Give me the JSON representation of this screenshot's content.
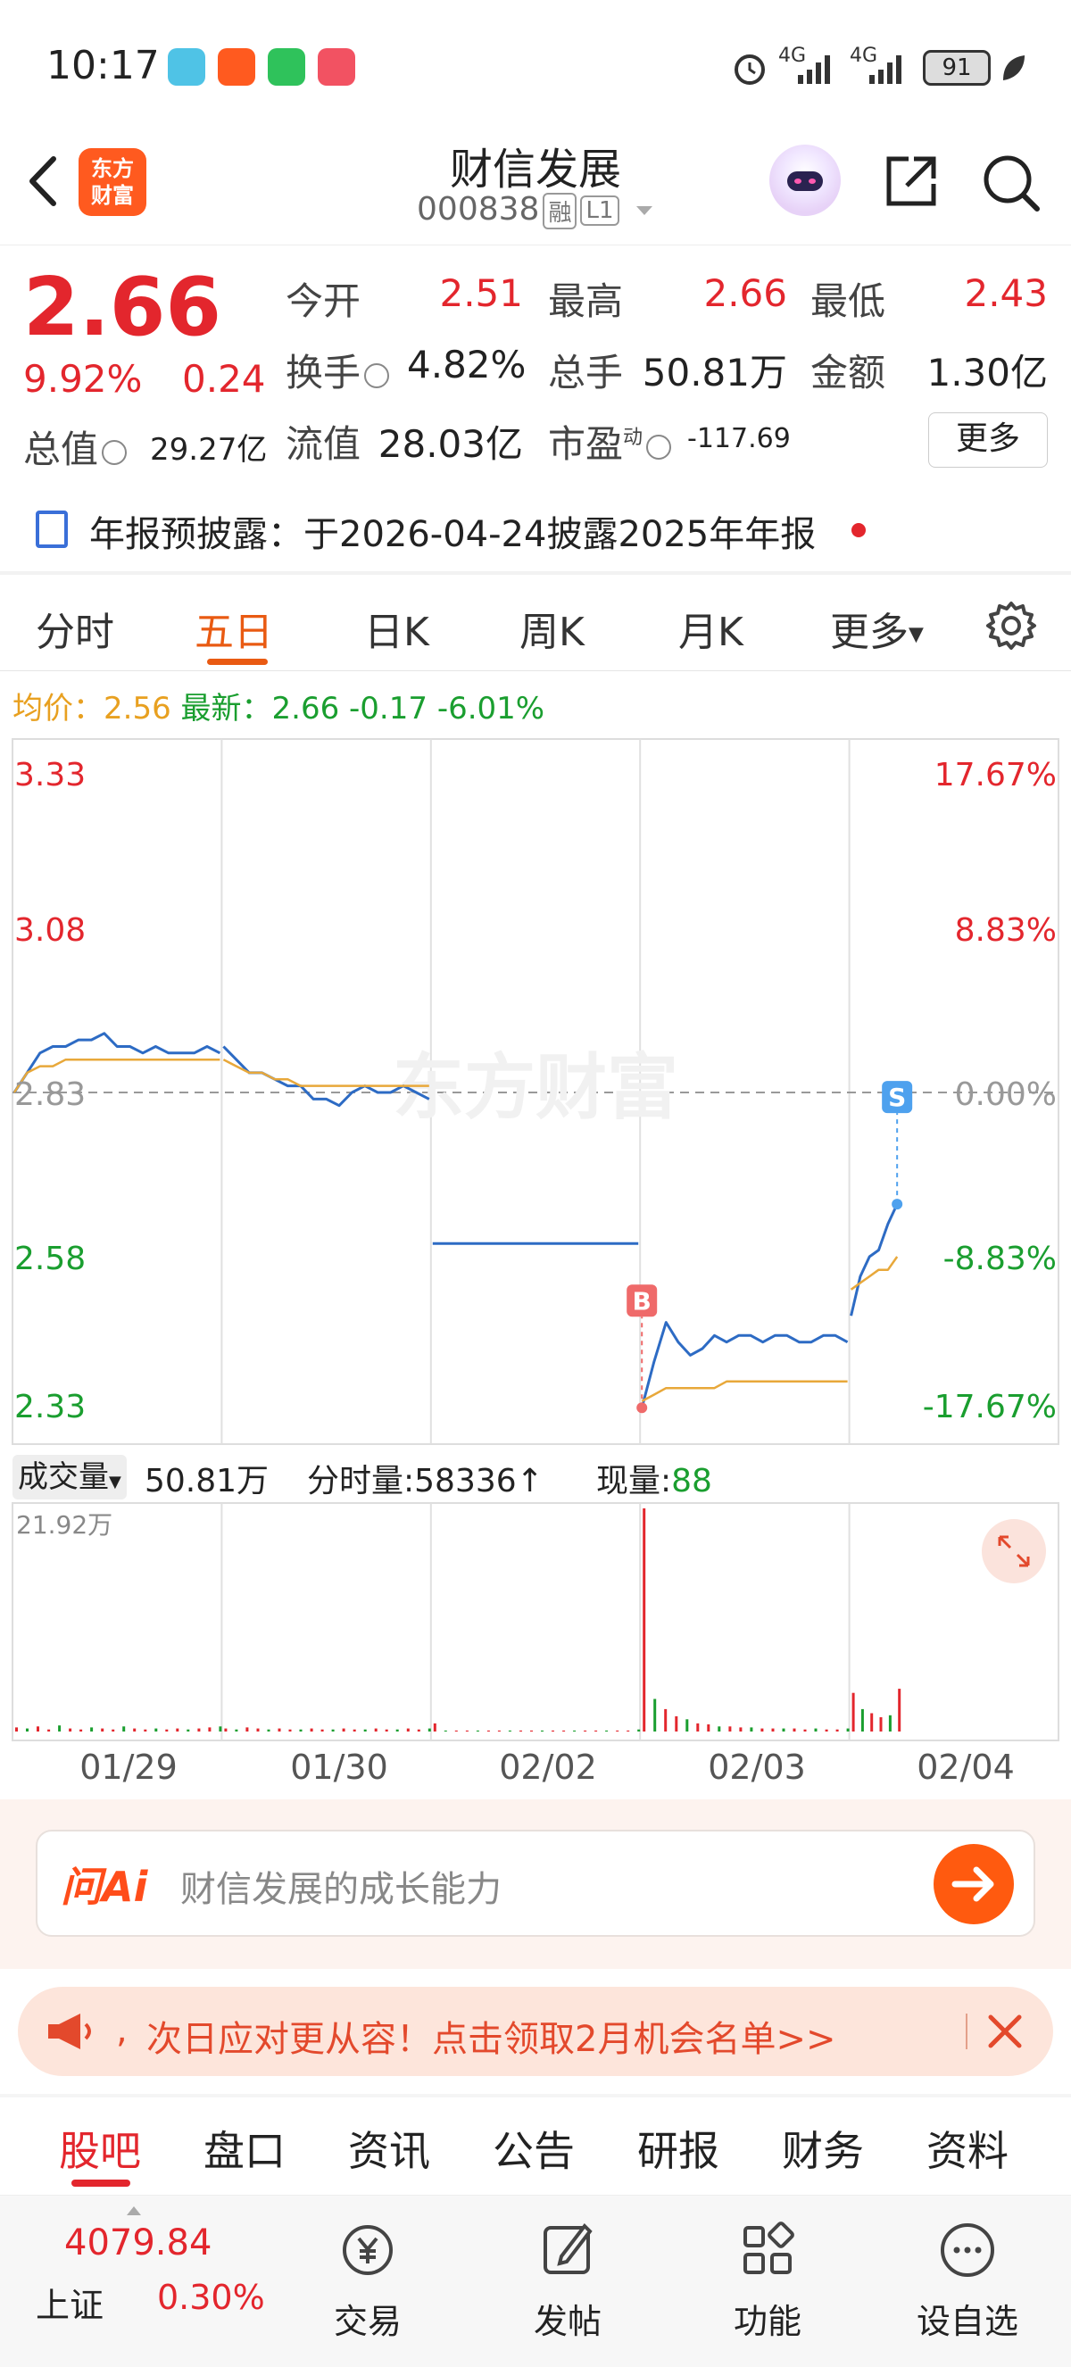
{
  "status_bar": {
    "time": "10:17",
    "network1": "4G",
    "network2": "4G",
    "battery": "91"
  },
  "header": {
    "logo_text_line1": "东方",
    "logo_text_line2": "财富",
    "stock_name": "财信发展",
    "stock_code": "000838",
    "tag_margin": "融",
    "tag_level": "L1"
  },
  "quote": {
    "price": "2.66",
    "change_pct": "9.92%",
    "change": "0.24",
    "market_value_label": "总值",
    "market_value": "29.27亿",
    "open_label": "今开",
    "open": "2.51",
    "high_label": "最高",
    "high": "2.66",
    "low_label": "最低",
    "low": "2.43",
    "turnover_label": "换手",
    "turnover": "4.82%",
    "volume_label": "总手",
    "volume": "50.81万",
    "amount_label": "金额",
    "amount": "1.30亿",
    "float_value_label": "流值",
    "float_value": "28.03亿",
    "pe_label": "市盈",
    "pe_superscript": "动",
    "pe": "-117.69",
    "more_button": "更多"
  },
  "disclosure": {
    "text": "年报预披露：于2026-04-24披露2025年年报"
  },
  "chart_tabs": [
    "分时",
    "五日",
    "日K",
    "周K",
    "月K",
    "更多"
  ],
  "chart_tab_active": "五日",
  "avg_line": {
    "avg_label": "均价：",
    "avg": "2.56",
    "latest_label": "最新：",
    "latest": "2.66",
    "change": "-0.17",
    "change_pct": "-6.01%"
  },
  "watermark": "东方财富",
  "chart_data": {
    "type": "line",
    "title": "",
    "x": [
      "01/29",
      "01/30",
      "02/02",
      "02/03",
      "02/04"
    ],
    "y_ticks_left": [
      "3.33",
      "3.08",
      "2.83",
      "2.58",
      "2.33"
    ],
    "y_ticks_right": [
      "17.67%",
      "8.83%",
      "0.00%",
      "-8.83%",
      "-17.67%"
    ],
    "ylim": [
      2.33,
      3.33
    ],
    "prev_close": 2.83,
    "grid": true,
    "series": [
      {
        "name": "",
        "color": "#2d6bc4",
        "days": [
          {
            "day": "01/29",
            "values": [
              2.83,
              2.86,
              2.89,
              2.9,
              2.9,
              2.91,
              2.91,
              2.92,
              2.9,
              2.9,
              2.89,
              2.9,
              2.89,
              2.89,
              2.89,
              2.9,
              2.89
            ]
          },
          {
            "day": "01/30",
            "values": [
              2.9,
              2.88,
              2.86,
              2.86,
              2.85,
              2.84,
              2.84,
              2.82,
              2.82,
              2.81,
              2.83,
              2.84,
              2.83,
              2.83,
              2.84,
              2.83,
              2.82
            ]
          },
          {
            "day": "02/02",
            "values": [
              2.6,
              2.6
            ]
          },
          {
            "day": "02/03",
            "values": [
              2.35,
              2.42,
              2.48,
              2.45,
              2.43,
              2.44,
              2.46,
              2.45,
              2.46,
              2.46,
              2.45,
              2.46,
              2.46,
              2.45,
              2.45,
              2.46,
              2.46,
              2.45
            ]
          },
          {
            "day": "02/04",
            "values": [
              2.49,
              2.55,
              2.58,
              2.59,
              2.63,
              2.66
            ]
          }
        ]
      },
      {
        "name": "",
        "color": "#e8a83a",
        "days": [
          {
            "day": "01/29",
            "values": [
              2.83,
              2.86,
              2.87,
              2.87,
              2.88,
              2.88,
              2.88,
              2.88,
              2.88,
              2.88,
              2.88,
              2.88,
              2.88,
              2.88,
              2.88,
              2.88,
              2.88
            ]
          },
          {
            "day": "01/30",
            "values": [
              2.88,
              2.87,
              2.86,
              2.86,
              2.85,
              2.85,
              2.84,
              2.84,
              2.84,
              2.84,
              2.84,
              2.84,
              2.84,
              2.84,
              2.84,
              2.84,
              2.84
            ]
          },
          {
            "day": "02/03",
            "values": [
              2.36,
              2.37,
              2.38,
              2.38,
              2.38,
              2.38,
              2.38,
              2.39,
              2.39,
              2.39,
              2.39,
              2.39,
              2.39,
              2.39,
              2.39,
              2.39,
              2.39,
              2.39
            ]
          },
          {
            "day": "02/04",
            "values": [
              2.53,
              2.54,
              2.55,
              2.56,
              2.56,
              2.58
            ]
          }
        ]
      }
    ],
    "markers": [
      {
        "label": "B",
        "day": "02/03",
        "value": 2.35,
        "color": "#ef6a6a"
      },
      {
        "label": "S",
        "day": "02/04",
        "value": 2.66,
        "color": "#4ea1ee"
      }
    ]
  },
  "volume": {
    "selector": "成交量",
    "total": "50.81万",
    "tick_label": "分时量:58336",
    "tick_arrow": "↑",
    "now_label": "现量:",
    "now_value": "88",
    "max_label": "21.92万",
    "max": 21.92,
    "bars": [
      {
        "day": "01/29",
        "values": [
          0.4,
          0.3,
          0.5,
          0.2,
          0.6,
          0.3,
          0.2,
          0.4,
          0.3,
          0.2,
          0.5,
          0.3,
          0.2,
          0.3,
          0.2,
          0.3,
          0.2,
          0.3,
          0.4,
          0.5
        ]
      },
      {
        "day": "01/30",
        "values": [
          0.3,
          0.2,
          0.4,
          0.3,
          0.2,
          0.3,
          0.2,
          0.2,
          0.3,
          0.2,
          0.2,
          0.3,
          0.2,
          0.2,
          0.3,
          0.2,
          0.2,
          0.3,
          0.2,
          0.3
        ]
      },
      {
        "day": "02/02",
        "values": [
          0.8,
          0.1,
          0.1,
          0.1,
          0.1,
          0.1,
          0.1,
          0.1,
          0.1,
          0.1,
          0.1,
          0.1,
          0.1,
          0.1,
          0.1,
          0.1,
          0.1,
          0.1,
          0.1,
          0.2
        ]
      },
      {
        "day": "02/03",
        "values": [
          21.92,
          3.2,
          2.2,
          1.5,
          1.2,
          0.8,
          0.7,
          0.5,
          0.5,
          0.4,
          0.4,
          0.3,
          0.3,
          0.3,
          0.3,
          0.2,
          0.3,
          0.2,
          0.2,
          0.3
        ]
      },
      {
        "day": "02/04",
        "values": [
          3.8,
          2.2,
          1.8,
          1.4,
          1.6,
          4.2
        ]
      }
    ]
  },
  "ask_ai": {
    "logo": "问Ai",
    "placeholder": "财信发展的成长能力"
  },
  "promo": {
    "text": "次日应对更从容！点击领取2月机会名单>>"
  },
  "bottom_tabs": [
    "股吧",
    "盘口",
    "资讯",
    "公告",
    "研报",
    "财务",
    "资料"
  ],
  "bottom_tab_active": "股吧",
  "navbar": {
    "index_value": "4079.84",
    "index_name": "上证",
    "index_pct": "0.30%",
    "items": [
      "交易",
      "发帖",
      "功能",
      "设自选"
    ]
  },
  "colors": {
    "up": "#e3262d",
    "down": "#1a9e2f",
    "accent": "#e95a12",
    "price_line": "#2d6bc4",
    "avg_line": "#e8a83a"
  }
}
